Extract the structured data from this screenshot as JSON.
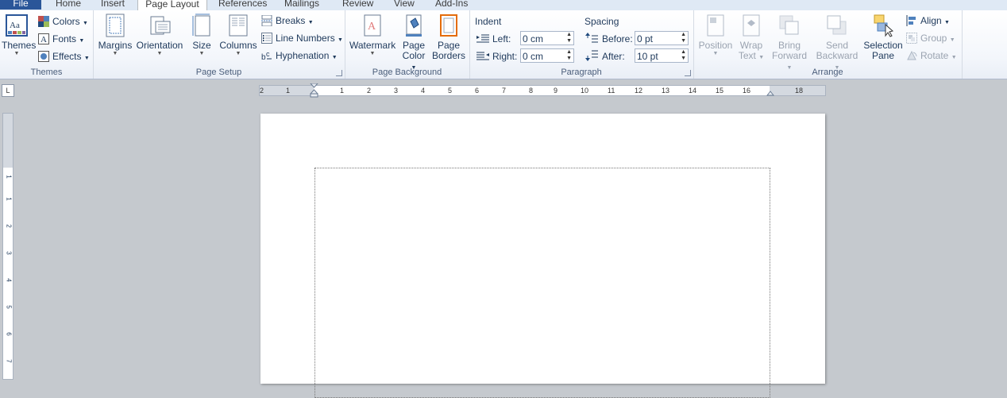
{
  "tabs": [
    "File",
    "Home",
    "Insert",
    "Page Layout",
    "References",
    "Mailings",
    "Review",
    "View",
    "Add-Ins"
  ],
  "groups": {
    "themes": {
      "label": "Themes",
      "themes": "Themes",
      "colors": "Colors",
      "fonts": "Fonts",
      "effects": "Effects"
    },
    "page_setup": {
      "label": "Page Setup",
      "margins": "Margins",
      "orientation": "Orientation",
      "size": "Size",
      "columns": "Columns",
      "breaks": "Breaks",
      "line_numbers": "Line Numbers",
      "hyphenation": "Hyphenation"
    },
    "page_background": {
      "label": "Page Background",
      "watermark": "Watermark",
      "page_color_1": "Page",
      "page_color_2": "Color",
      "page_borders_1": "Page",
      "page_borders_2": "Borders"
    },
    "paragraph": {
      "label": "Paragraph",
      "indent": "Indent",
      "left_label": "Left:",
      "left_value": "0 cm",
      "right_label": "Right:",
      "right_value": "0 cm",
      "spacing": "Spacing",
      "before_label": "Before:",
      "before_value": "0 pt",
      "after_label": "After:",
      "after_value": "10 pt"
    },
    "arrange": {
      "label": "Arrange",
      "position": "Position",
      "wrap_1": "Wrap",
      "wrap_2": "Text",
      "bring_1": "Bring",
      "bring_2": "Forward",
      "send_1": "Send",
      "send_2": "Backward",
      "selection_1": "Selection",
      "selection_2": "Pane",
      "align": "Align",
      "group": "Group",
      "rotate": "Rotate"
    }
  },
  "ruler": {
    "corner": "L",
    "h_labels": [
      "2",
      "1",
      "1",
      "2",
      "3",
      "4",
      "5",
      "6",
      "7",
      "8",
      "9",
      "10",
      "11",
      "12",
      "13",
      "14",
      "15",
      "16",
      "18"
    ],
    "v_labels": [
      "1",
      "1",
      "2",
      "3",
      "4",
      "5",
      "6",
      "7"
    ]
  },
  "colors": {
    "file_tab": "#2a5699",
    "workspace": "#c5c9ce"
  }
}
